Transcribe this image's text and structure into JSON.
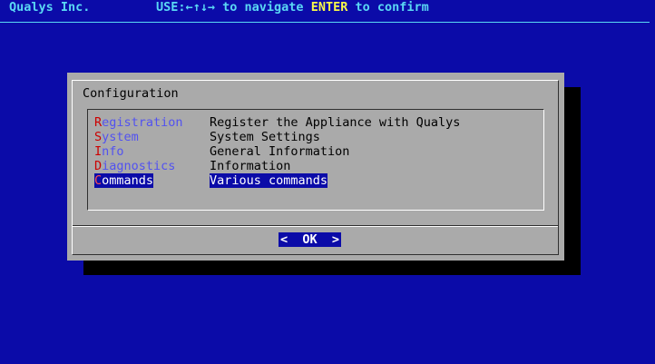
{
  "header": {
    "brand": "Qualys Inc.",
    "help_prefix": "USE:",
    "help_arrows": "←↑↓→",
    "help_mid": " to navigate ",
    "help_key": "ENTER",
    "help_suffix": " to confirm"
  },
  "dialog": {
    "title": "Configuration",
    "menu_items": [
      {
        "tag_first": "R",
        "tag_rest": "egistration",
        "description": "Register the Appliance with Qualys",
        "selected": false
      },
      {
        "tag_first": "S",
        "tag_rest": "ystem",
        "description": "System Settings",
        "selected": false
      },
      {
        "tag_first": "I",
        "tag_rest": "nfo",
        "description": "General Information",
        "selected": false
      },
      {
        "tag_first": "D",
        "tag_rest": "iagnostics",
        "description": "Information",
        "selected": false
      },
      {
        "tag_first": "C",
        "tag_rest": "ommands",
        "description": "Various commands",
        "selected": true
      }
    ],
    "ok_label": "<  OK  >"
  },
  "colors": {
    "background": "#0b0ba8",
    "header_text": "#5ad8f4",
    "header_highlight": "#f7f74a",
    "dialog_face": "#aaaaaa",
    "hotkey": "#cc0000",
    "tag_text": "#5252f0",
    "selection": "#0b0ba8"
  }
}
